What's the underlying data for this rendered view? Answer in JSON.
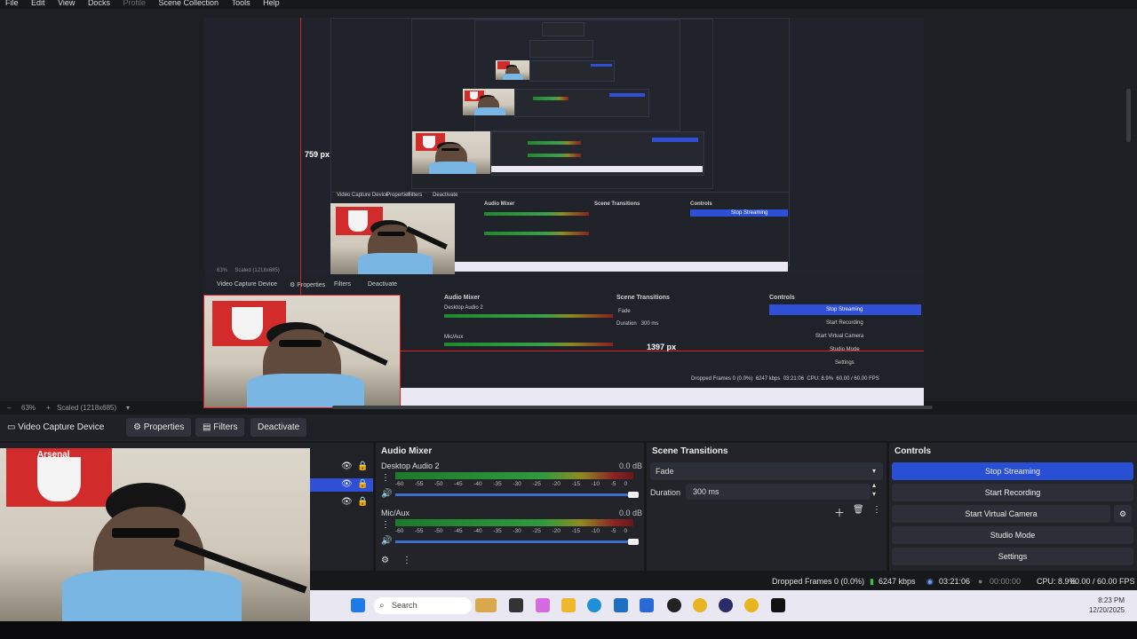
{
  "menu": [
    "File",
    "Edit",
    "View",
    "Docks",
    "Profile",
    "Scene Collection",
    "Tools",
    "Help"
  ],
  "menu_disabled": [
    "Profile"
  ],
  "preview": {
    "measure_vertical": "759 px",
    "measure_horizontal": "1397 px"
  },
  "zoom": {
    "level": "63%",
    "scale_label": "Scaled (1218x685)"
  },
  "source_toolbar": {
    "source_name": "Video Capture Device",
    "properties": "Properties",
    "filters": "Filters",
    "deactivate": "Deactivate"
  },
  "audio_mixer": {
    "title": "Audio Mixer",
    "channels": [
      {
        "name": "Desktop Audio 2",
        "db": "0.0 dB"
      },
      {
        "name": "Mic/Aux",
        "db": "0.0 dB"
      }
    ],
    "ticks": [
      "-60",
      "-55",
      "-50",
      "-45",
      "-40",
      "-35",
      "-30",
      "-25",
      "-20",
      "-15",
      "-10",
      "-5",
      "0"
    ]
  },
  "scene_transitions": {
    "title": "Scene Transitions",
    "transition": "Fade",
    "duration_label": "Duration",
    "duration_value": "300 ms"
  },
  "controls": {
    "title": "Controls",
    "buttons": [
      "Stop Streaming",
      "Start Recording",
      "Start Virtual Camera",
      "Studio Mode",
      "Settings"
    ]
  },
  "status": {
    "dropped_frames": "Dropped Frames 0 (0.0%)",
    "bitrate": "6247 kbps",
    "stream_time": "03:21:06",
    "record_time": "00:00:00",
    "cpu": "CPU: 8.9%",
    "fps": "60.00 / 60.00 FPS"
  },
  "taskbar": {
    "search_placeholder": "Search",
    "time": "8:23 PM",
    "date": "12/20/2025"
  },
  "webcam": {
    "flag_text": "Arsenal"
  },
  "colors": {
    "accent": "#2950d4",
    "measure_line": "#e02020",
    "meter_green": "#2f9a3e"
  }
}
